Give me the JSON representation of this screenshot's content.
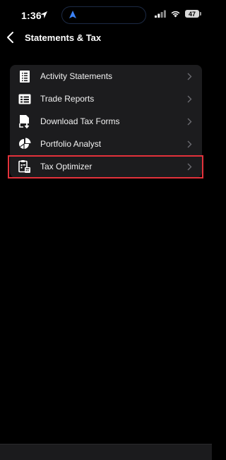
{
  "status": {
    "time": "1:36",
    "battery": "47",
    "icons": [
      "location-arrow-icon",
      "navigation-icon",
      "signal-icon",
      "wifi-icon",
      "battery-icon"
    ]
  },
  "header": {
    "title": "Statements & Tax",
    "back_icon": "back-chevron-icon"
  },
  "menu": {
    "items": [
      {
        "label": "Activity Statements",
        "icon": "statement-icon"
      },
      {
        "label": "Trade Reports",
        "icon": "report-icon"
      },
      {
        "label": "Download Tax Forms",
        "icon": "download-form-icon"
      },
      {
        "label": "Portfolio Analyst",
        "icon": "pie-chart-icon"
      },
      {
        "label": "Tax Optimizer",
        "icon": "tax-optimizer-icon"
      }
    ]
  },
  "colors": {
    "background": "#000000",
    "row_background": "#1c1c1e",
    "highlight": "#e3323b",
    "nav_blue": "#3b82f6"
  }
}
